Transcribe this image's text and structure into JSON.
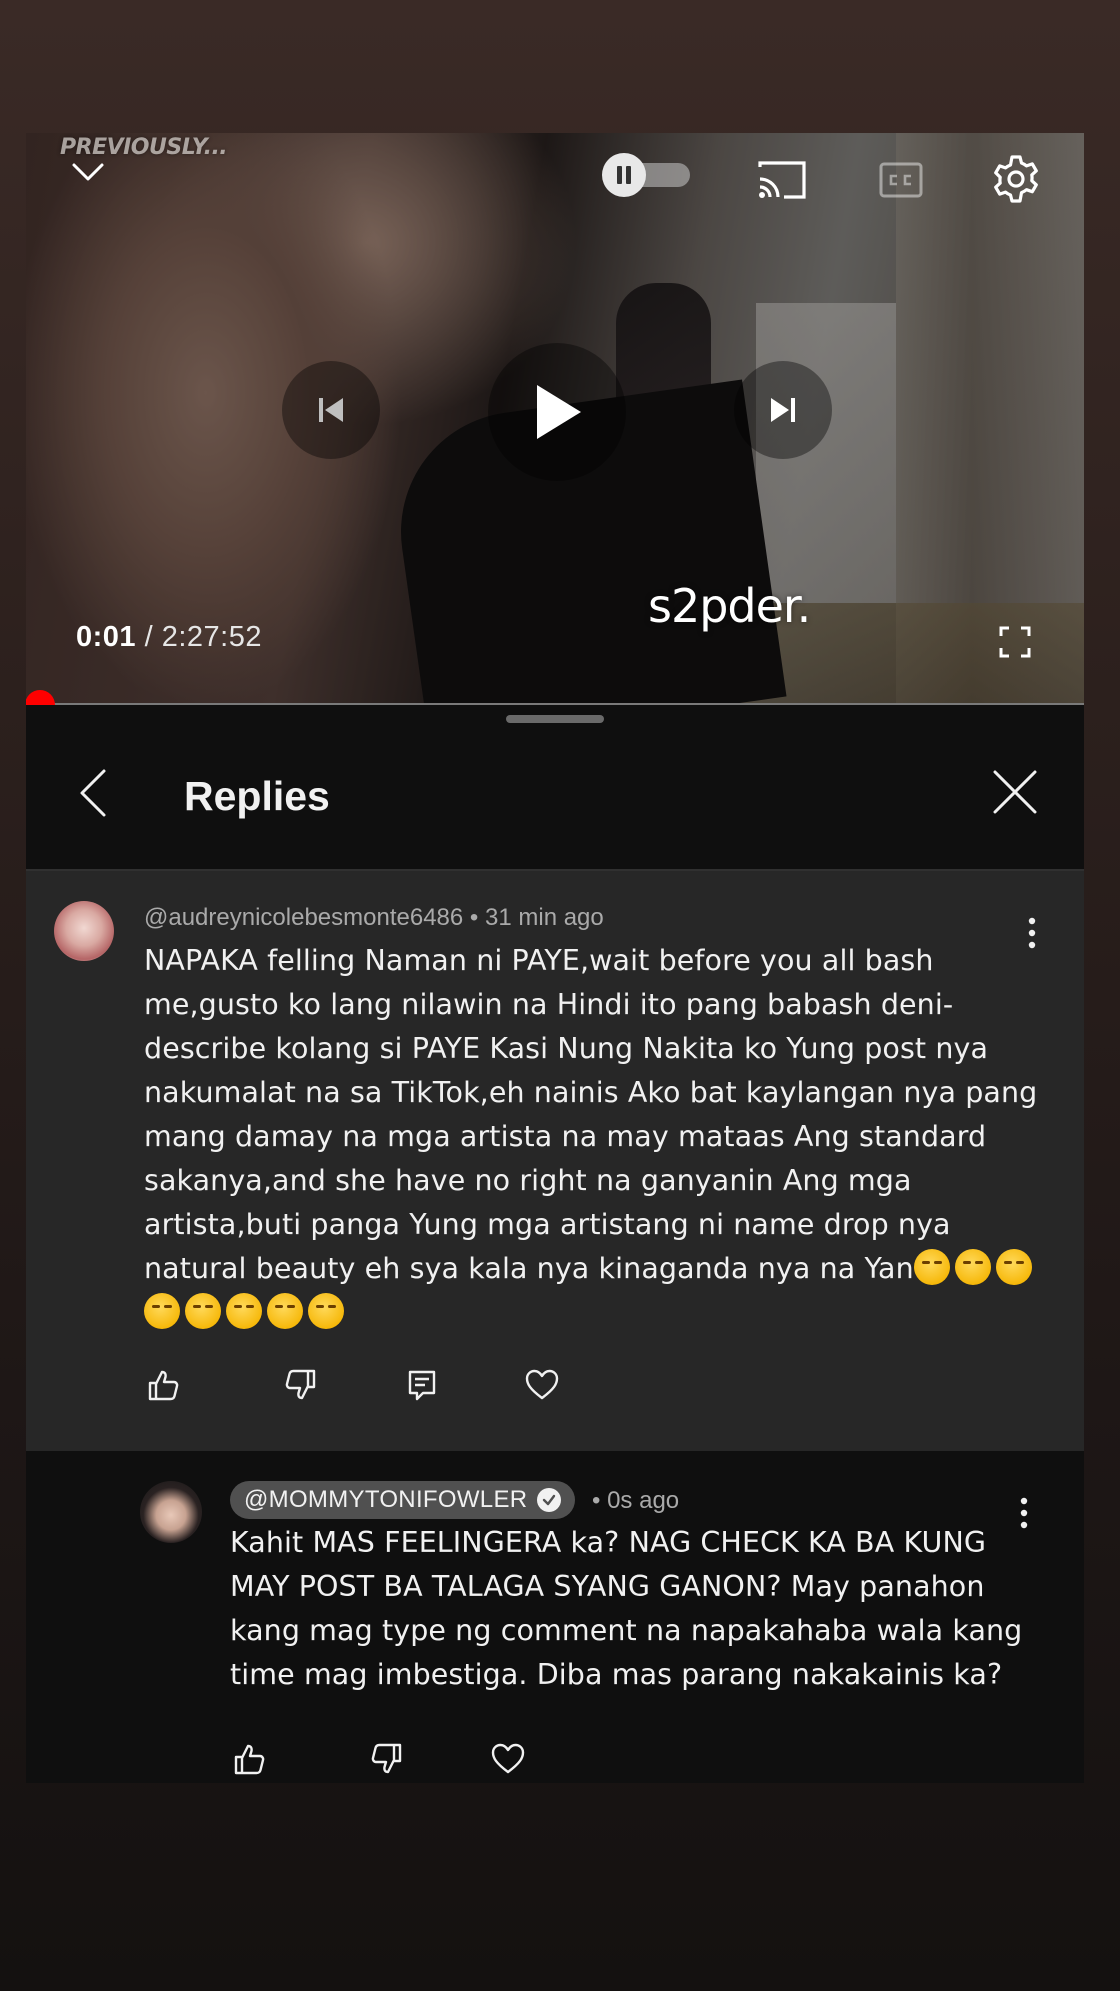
{
  "player": {
    "overlay_text": "PREVIOUSLY...",
    "current_time": "0:01",
    "separator": " / ",
    "duration": "2:27:52",
    "watermark": "s2pder.",
    "progress_fraction": 0.0002,
    "icons": {
      "collapse": "chevron-down-icon",
      "autoplay": "autoplay-toggle",
      "cast": "cast-icon",
      "captions": "cc-icon",
      "settings": "gear-icon",
      "previous": "skip-previous-icon",
      "play": "play-icon",
      "next": "skip-next-icon",
      "fullscreen": "fullscreen-icon"
    }
  },
  "panel": {
    "title": "Replies",
    "back_icon": "chevron-left-icon",
    "close_icon": "close-icon"
  },
  "comment": {
    "author": "@audreynicolebesmonte6486",
    "time": "31 min ago",
    "text": "NAPAKA felling Naman ni PAYE,wait before you all bash me,gusto ko lang nilawin na Hindi ito pang babash deni-describe kolang si PAYE Kasi Nung Nakita ko Yung post nya nakumalat na sa TikTok,eh nainis Ako bat kaylangan nya pang mang damay na mga artista na may mataas Ang standard sakanya,and she have no right na ganyanin Ang mga artista,buti panga Yung mga artistang ni name drop nya natural beauty eh sya kala nya kinaganda nya na Yan",
    "emoji_count": 8,
    "actions": [
      "thumbs-up-icon",
      "thumbs-down-icon",
      "reply-icon",
      "heart-icon"
    ]
  },
  "reply": {
    "author": "@MOMMYTONIFOWLER",
    "verified": true,
    "time": "0s ago",
    "text": "Kahit MAS FEELINGERA ka? NAG CHECK KA BA KUNG MAY POST BA TALAGA SYANG GANON? May panahon kang mag type ng comment na napakahaba wala kang time mag imbestiga. Diba mas parang nakakainis ka?",
    "actions": [
      "thumbs-up-icon",
      "thumbs-down-icon",
      "heart-icon"
    ]
  },
  "colors": {
    "progress": "#ff0000",
    "comment_bg": "#272727",
    "reply_bg": "#0f0f0f",
    "text": "#f1f1f1",
    "meta": "#aaaaaa"
  }
}
